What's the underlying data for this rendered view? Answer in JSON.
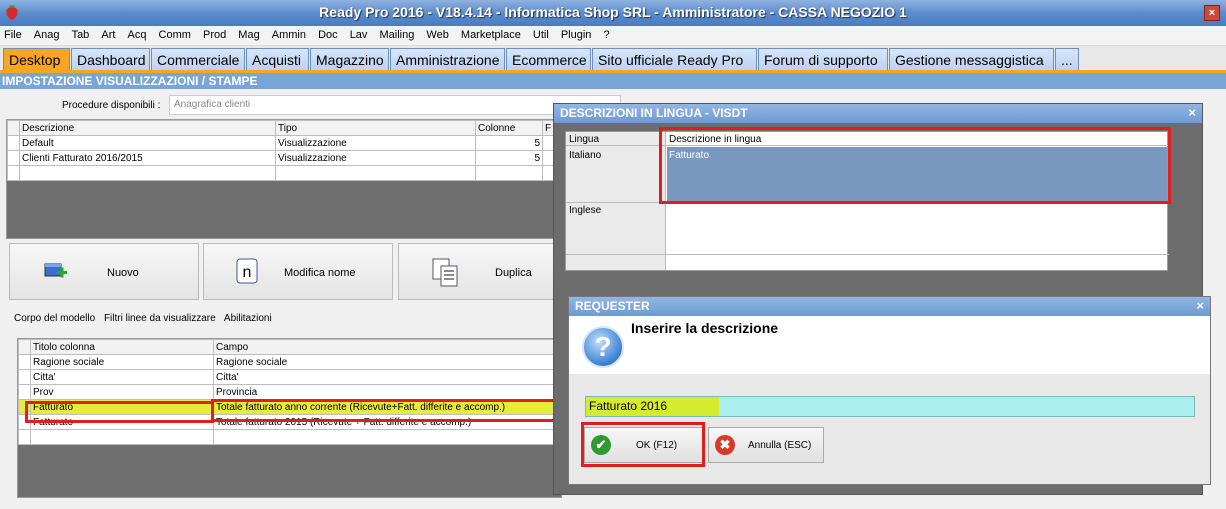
{
  "window": {
    "title": "Ready Pro 2016 - V18.4.14 - Informatica Shop SRL - Amministratore - CASSA NEGOZIO 1",
    "close": "×"
  },
  "menu": [
    "File",
    "Anag",
    "Tab",
    "Art",
    "Acq",
    "Comm",
    "Prod",
    "Mag",
    "Ammin",
    "Doc",
    "Lav",
    "Mailing",
    "Web",
    "Marketplace",
    "Util",
    "Plugin",
    "?"
  ],
  "tabs": [
    "Desktop",
    "Dashboard",
    "Commerciale",
    "Acquisti",
    "Magazzino",
    "Amministrazione",
    "Ecommerce",
    "Sito ufficiale Ready Pro",
    "Forum di supporto",
    "Gestione messaggistica",
    "..."
  ],
  "section": {
    "title": "IMPOSTAZIONE VISUALIZZAZIONI / STAMPE"
  },
  "procedure": {
    "label": "Procedure disponibili :",
    "value": "Anagrafica clienti"
  },
  "models_table": {
    "headers": [
      "Descrizione",
      "Tipo",
      "Colonne",
      "F"
    ],
    "rows": [
      [
        "Default",
        "Visualizzazione",
        "5"
      ],
      [
        "Clienti Fatturato 2016/2015",
        "Visualizzazione",
        "5"
      ]
    ]
  },
  "buttons": {
    "nuovo": "Nuovo",
    "modifica": "Modifica nome",
    "duplica": "Duplica"
  },
  "subtabs": [
    "Corpo del modello",
    "Filtri linee da visualizzare",
    "Abilitazioni"
  ],
  "columns_table": {
    "headers": [
      "Titolo colonna",
      "Campo"
    ],
    "rows": [
      [
        "Ragione sociale",
        "Ragione sociale"
      ],
      [
        "Citta'",
        "Citta'"
      ],
      [
        "Prov",
        "Provincia"
      ],
      [
        "Fatturato",
        "Totale fatturato anno corrente (Ricevute+Fatt. differite e accomp.)"
      ],
      [
        "Fatturato",
        "Totale fatturato 2015 (Ricevute + Fatt. differite e accomp.)"
      ]
    ]
  },
  "dialog_lang": {
    "title": "DESCRIZIONI IN LINGUA - VISDT",
    "close": "×",
    "col_lingua": "Lingua",
    "col_desc": "Descrizione in lingua",
    "rows": [
      {
        "lang": "Italiano",
        "desc": "Fatturato"
      },
      {
        "lang": "Inglese",
        "desc": ""
      }
    ]
  },
  "requester": {
    "title": "REQUESTER",
    "close": "×",
    "icon": "?",
    "message": "Inserire la descrizione",
    "input_value": "Fatturato 2016",
    "ok": "OK (F12)",
    "cancel": "Annulla (ESC)",
    "ok_icon": "✔",
    "cancel_icon": "✖"
  }
}
